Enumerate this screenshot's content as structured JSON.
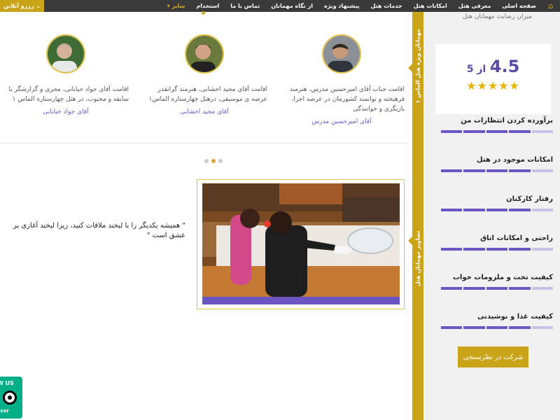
{
  "nav": {
    "home_icon": "home-icon",
    "items": [
      "صفحه اصلی",
      "معرفی هتل",
      "امکانات هتل",
      "خدمات هتل",
      "پیشنهاد ویژه",
      "از نگاه مهمانان",
      "تماس با ما",
      "استخدام",
      "سایر"
    ],
    "booking_label": "رزرو آنلاین"
  },
  "sidebar": {
    "title": "میزان رضایت مهمانان هتل",
    "score_value": "4.5",
    "score_of": "از 5",
    "criteria": [
      {
        "label": "برآورده کردن انتظارات من",
        "rating": 4.5
      },
      {
        "label": "امکانات موجود در هتل",
        "rating": 4.5
      },
      {
        "label": "رفتار کارکنان",
        "rating": 4.5
      },
      {
        "label": "راحتی و امکانات اتاق",
        "rating": 4.5
      },
      {
        "label": "کیفیت تخت و ملزومات خواب",
        "rating": 4.5
      },
      {
        "label": "کیفیت غذا و نوشیدنی",
        "rating": 4.5
      }
    ],
    "vote_button": "شرکت در نظرسنجی"
  },
  "strip": {
    "label_top": "مهمانان ویژه هتل الماس ۱",
    "label_bottom": "تصاویر مهمانان هتل"
  },
  "guests": [
    {
      "text": "اقامت جناب آقای امیرحسین مدرس، هنرمند فرهیخته و توانمند کشورمان در عرصه اجرا، بازیگری و خوانندگی",
      "name": "آقای امیرحسین مدرس"
    },
    {
      "text": "اقامت آقای مجید اخشابی، هنرمند گرانقدر عرصه ی موسیقی، درهتل چهارستاره الماس۱",
      "name": "آقای مجید اخشابی"
    },
    {
      "text": "اقامت آقای جواد خیابانی، مجری و گزارشگر با سابقه و محبوب، در هتل چهارستاره الماس ۱",
      "name": "آقای جواد خیابانی"
    }
  ],
  "quote": "\" همیشه یکدیگر را با لبخند ملاقات کنید، زیرا لبخند آغازی بر عشق است \"",
  "badge": {
    "line1": "W US",
    "line2": "isor"
  }
}
